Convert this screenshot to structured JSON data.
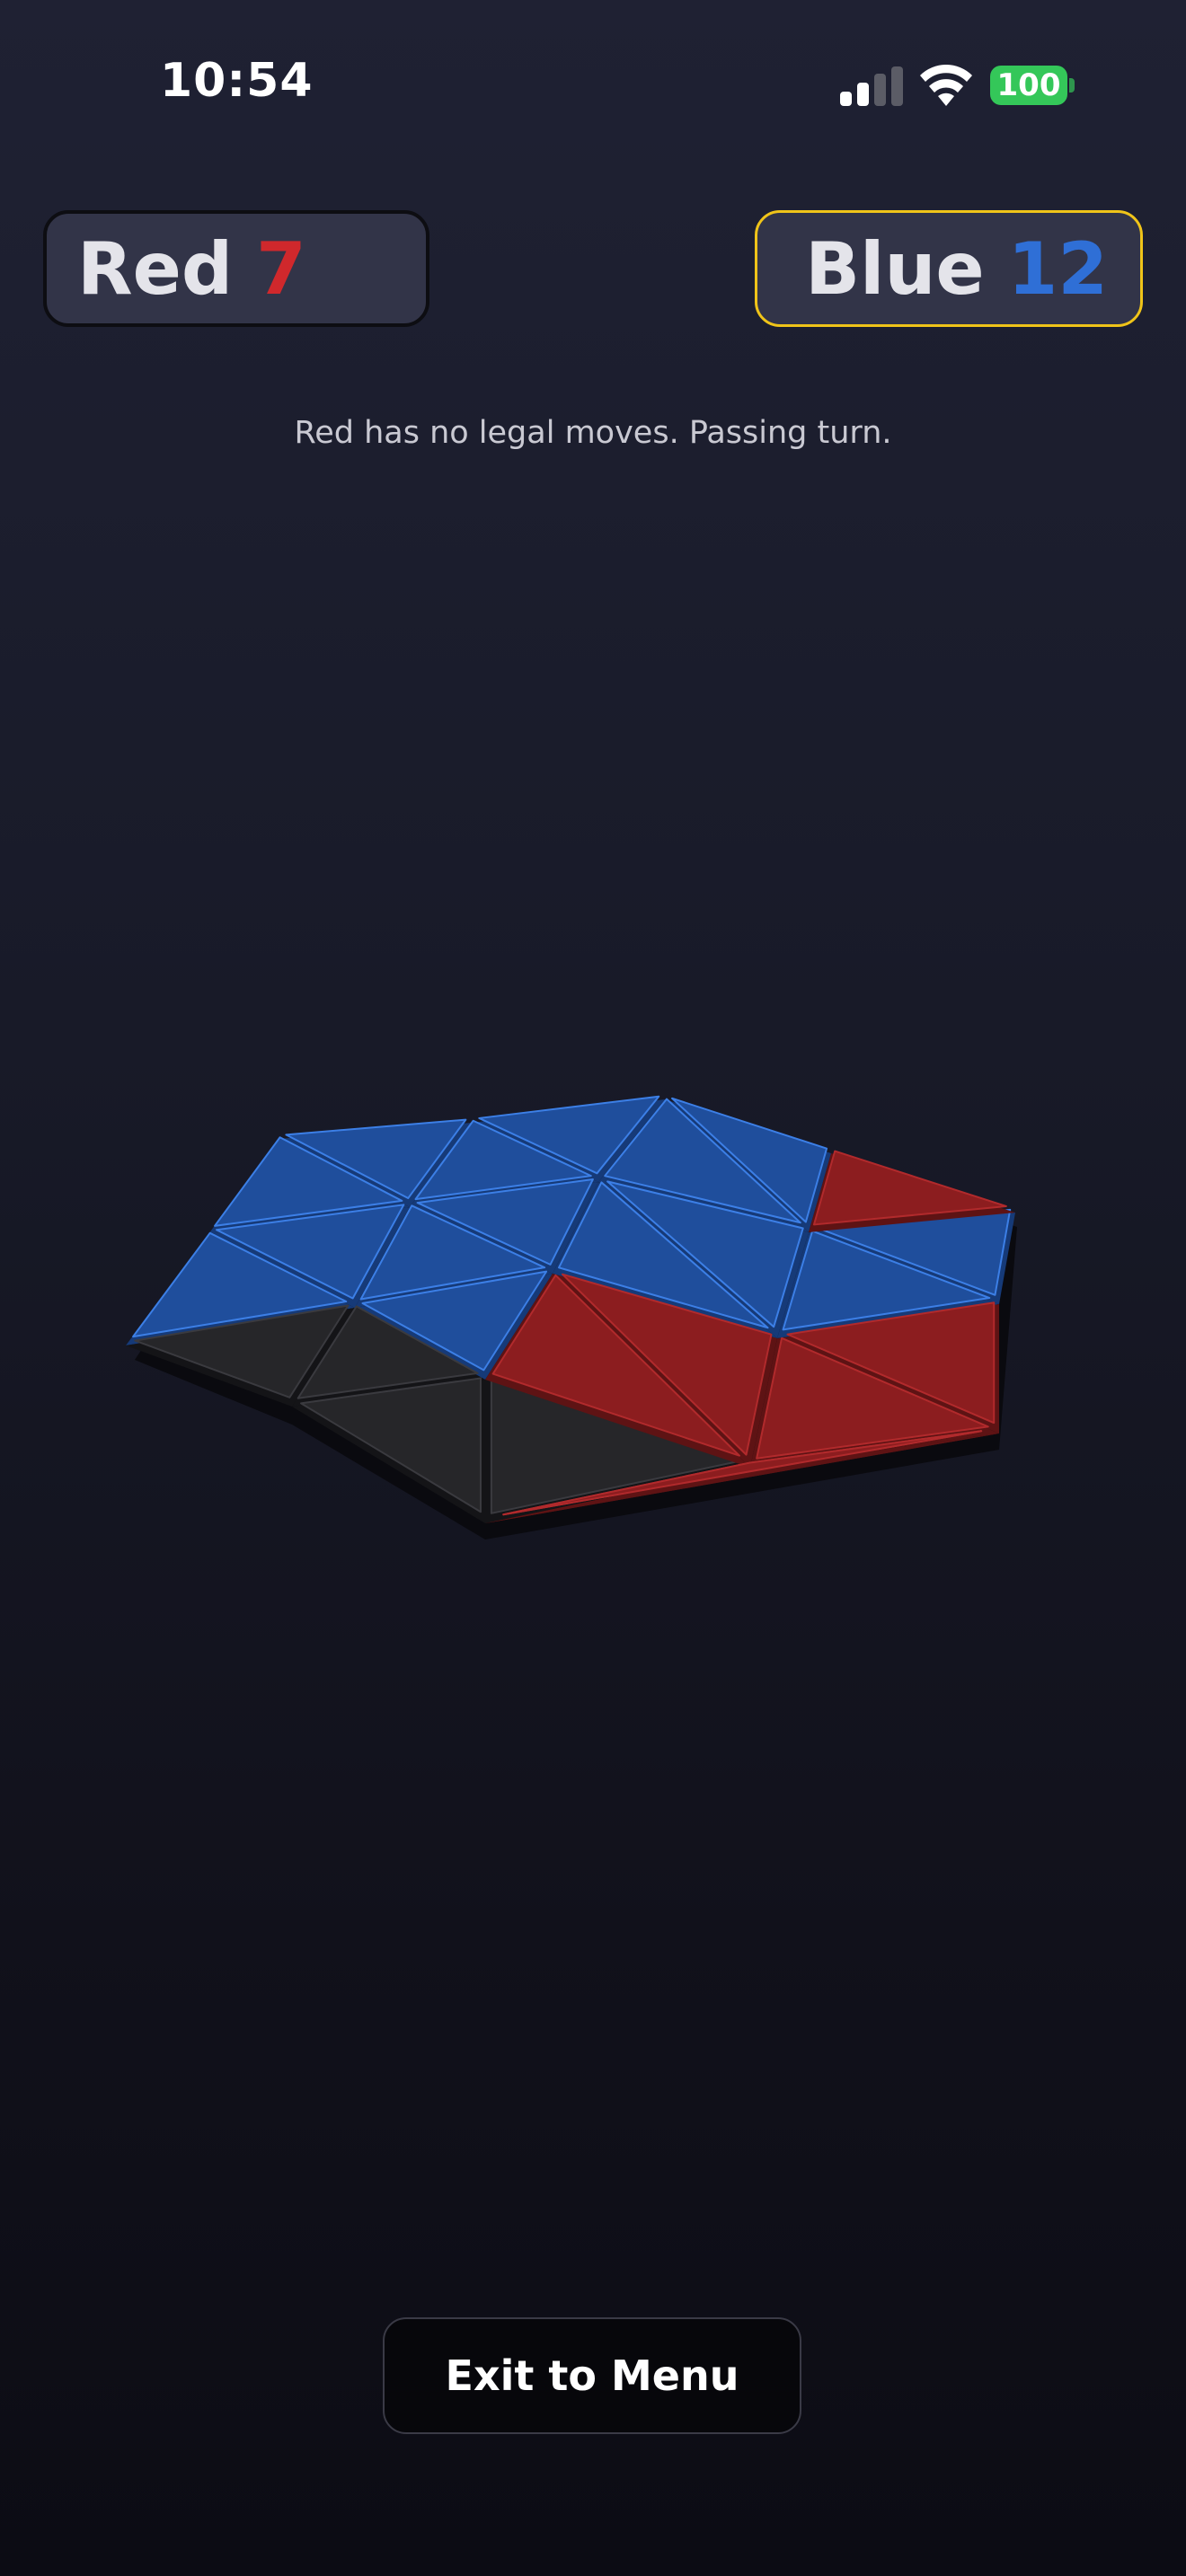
{
  "status_bar": {
    "time": "10:54",
    "battery": "100",
    "icons": [
      "cellular-signal-icon",
      "wifi-icon",
      "battery-icon"
    ]
  },
  "scores": {
    "red": {
      "label": "Red",
      "value": "7",
      "color": "#d0282c",
      "is_current_turn": false
    },
    "blue": {
      "label": "Blue",
      "value": "12",
      "color": "#2f6fd6",
      "is_current_turn": true
    }
  },
  "message": "Red has no legal moves. Passing turn.",
  "board": {
    "colors": {
      "red": "#8c1d1f",
      "blue": "#1f4e9c",
      "empty": "#262629",
      "highlight": "#f0c419"
    },
    "cells": [
      "blue",
      "blue",
      "blue",
      "blue",
      "blue",
      "blue",
      "blue",
      "blue",
      "blue",
      "blue",
      "blue",
      "blue",
      "blue",
      "blue",
      "empty",
      "blue",
      "empty",
      "empty",
      "red",
      "red",
      "empty",
      "red",
      "red",
      "red",
      "red",
      "red"
    ]
  },
  "exit_button": {
    "label": "Exit to Menu"
  }
}
